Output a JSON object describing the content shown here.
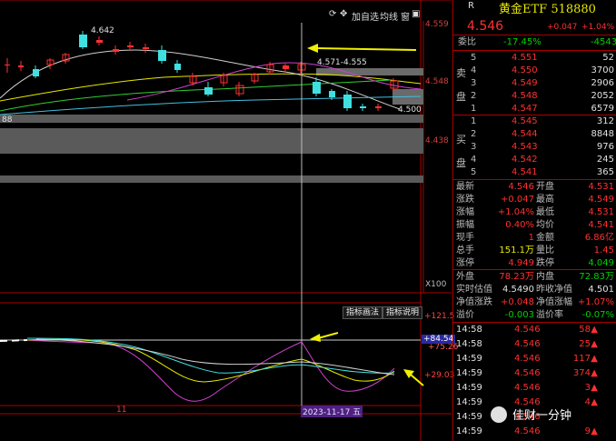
{
  "toolbar": {
    "btn_add": "加自选",
    "btn_period": "均线",
    "btn_window": "窗"
  },
  "main_chart": {
    "price_ticks": [
      "4.559",
      "4.548",
      "4.438"
    ],
    "high_label": "4.642",
    "range_label": "4.571-4.555",
    "low_label": "4.500",
    "left_label": "88",
    "x_multiplier": "X100"
  },
  "indicator": {
    "btn_draw": "指标画法",
    "btn_help": "指标说明",
    "ticks": [
      "+121.5",
      "+75.26",
      "+29.03"
    ],
    "value_tag": "+84.54",
    "date_tag": "2023-11-17 五",
    "axis_label": "11"
  },
  "quote": {
    "code_label": "R",
    "name": "黄金ETF 518880",
    "price": "4.546",
    "change": "+0.047",
    "change_pct": "+1.04%",
    "weibi_label": "委比",
    "weibi_value": "-17.45%",
    "weicha_value": "-4543"
  },
  "ask_label": "卖盘",
  "bid_label": "买盘",
  "asks": [
    {
      "level": "5",
      "price": "4.551",
      "vol": "52"
    },
    {
      "level": "4",
      "price": "4.550",
      "vol": "3700"
    },
    {
      "level": "3",
      "price": "4.549",
      "vol": "2906"
    },
    {
      "level": "2",
      "price": "4.548",
      "vol": "2052"
    },
    {
      "level": "1",
      "price": "4.547",
      "vol": "6579"
    }
  ],
  "bids": [
    {
      "level": "1",
      "price": "4.545",
      "vol": "312"
    },
    {
      "level": "2",
      "price": "4.544",
      "vol": "8848"
    },
    {
      "level": "3",
      "price": "4.543",
      "vol": "976"
    },
    {
      "level": "4",
      "price": "4.542",
      "vol": "245"
    },
    {
      "level": "5",
      "price": "4.541",
      "vol": "365"
    }
  ],
  "stats": [
    {
      "l1": "最新",
      "v1": "4.546",
      "l2": "开盘",
      "v2": "4.531"
    },
    {
      "l1": "涨跌",
      "v1": "+0.047",
      "l2": "最高",
      "v2": "4.549"
    },
    {
      "l1": "涨幅",
      "v1": "+1.04%",
      "l2": "最低",
      "v2": "4.531"
    },
    {
      "l1": "振幅",
      "v1": "0.40%",
      "l2": "均价",
      "v2": "4.541"
    },
    {
      "l1": "现手",
      "v1": "1",
      "l2": "金额",
      "v2": "6.86亿"
    },
    {
      "l1": "总手",
      "v1": "151.1万",
      "l2": "量比",
      "v2": "1.45"
    },
    {
      "l1": "涨停",
      "v1": "4.949",
      "l2": "跌停",
      "v2": "4.049"
    }
  ],
  "stats2": [
    {
      "l1": "外盘",
      "v1": "78.23万",
      "l2": "内盘",
      "v2": "72.83万"
    },
    {
      "l1": "实时估值",
      "v1": "4.5490",
      "l2": "昨收净值",
      "v2": "4.501"
    },
    {
      "l1": "净值涨跌",
      "v1": "+0.048",
      "l2": "净值涨幅",
      "v2": "+1.07%"
    },
    {
      "l1": "溢价",
      "v1": "-0.003",
      "l2": "溢价率",
      "v2": "-0.07%"
    }
  ],
  "ticks": [
    {
      "time": "14:58",
      "price": "4.546",
      "vol": "58"
    },
    {
      "time": "14:58",
      "price": "4.546",
      "vol": "25"
    },
    {
      "time": "14:59",
      "price": "4.546",
      "vol": "117"
    },
    {
      "time": "14:59",
      "price": "4.546",
      "vol": "374"
    },
    {
      "time": "14:59",
      "price": "4.546",
      "vol": "3"
    },
    {
      "time": "14:59",
      "price": "4.546",
      "vol": "4"
    },
    {
      "time": "14:59",
      "price": "4.546",
      "vol": ""
    },
    {
      "time": "14:59",
      "price": "4.546",
      "vol": "9"
    }
  ],
  "watermark": "佳财一分钟"
}
